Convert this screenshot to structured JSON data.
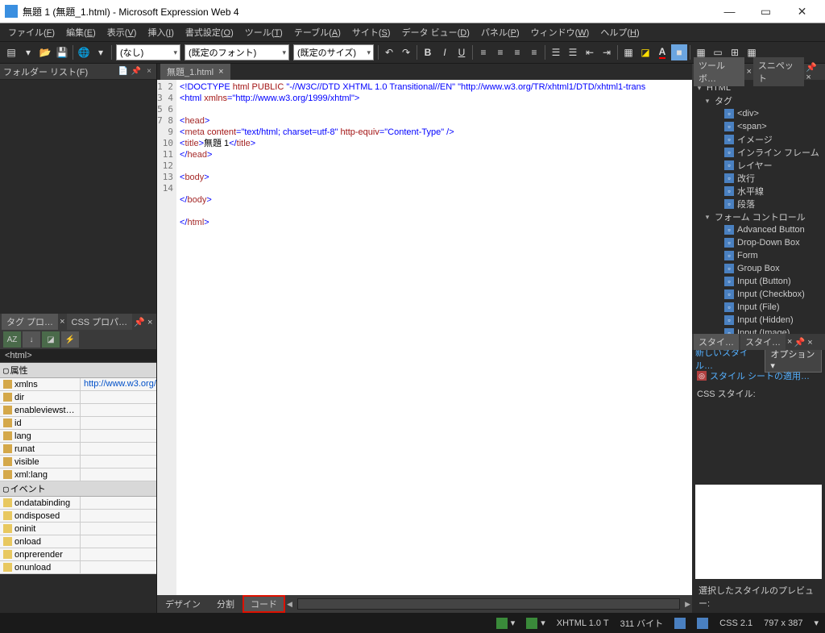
{
  "window": {
    "title": "無題 1 (無題_1.html) - Microsoft Expression Web 4"
  },
  "menus": [
    {
      "label": "ファイル",
      "mnemonic": "F"
    },
    {
      "label": "編集",
      "mnemonic": "E"
    },
    {
      "label": "表示",
      "mnemonic": "V"
    },
    {
      "label": "挿入",
      "mnemonic": "I"
    },
    {
      "label": "書式設定",
      "mnemonic": "O"
    },
    {
      "label": "ツール",
      "mnemonic": "T"
    },
    {
      "label": "テーブル",
      "mnemonic": "A"
    },
    {
      "label": "サイト",
      "mnemonic": "S"
    },
    {
      "label": "データ ビュー",
      "mnemonic": "D"
    },
    {
      "label": "パネル",
      "mnemonic": "P"
    },
    {
      "label": "ウィンドウ",
      "mnemonic": "W"
    },
    {
      "label": "ヘルプ",
      "mnemonic": "H"
    }
  ],
  "toolbar": {
    "style_combo": "(なし)",
    "font_combo": "(既定のフォント)",
    "size_combo": "(既定のサイズ)"
  },
  "folder_panel": {
    "title": "フォルダー リスト(F)"
  },
  "tag_panel": {
    "tab1": "タグ プロ…",
    "tab2": "CSS プロパ…",
    "crumb": "<html>",
    "group_attr": "属性",
    "attrs": [
      {
        "name": "xmlns",
        "value": "http://www.w3.org/…"
      },
      {
        "name": "dir",
        "value": ""
      },
      {
        "name": "enableviewst…",
        "value": ""
      },
      {
        "name": "id",
        "value": ""
      },
      {
        "name": "lang",
        "value": ""
      },
      {
        "name": "runat",
        "value": ""
      },
      {
        "name": "visible",
        "value": ""
      },
      {
        "name": "xml:lang",
        "value": ""
      }
    ],
    "group_event": "イベント",
    "events": [
      "ondatabinding",
      "ondisposed",
      "oninit",
      "onload",
      "onprerender",
      "onunload"
    ]
  },
  "doc": {
    "tab": "無題_1.html",
    "line_numbers": [
      "1",
      "2",
      "3",
      "4",
      "5",
      "6",
      "7",
      "8",
      "9",
      "10",
      "11",
      "12",
      "13",
      "14"
    ],
    "lines": [
      {
        "segs": [
          {
            "c": "t-blue",
            "t": "<!DOCTYPE"
          },
          {
            "c": "t-red",
            "t": " html PUBLIC "
          },
          {
            "c": "t-blue",
            "t": "\"-//W3C//DTD XHTML 1.0 Transitional//EN\" \"http://www.w3.org/TR/xhtml1/DTD/xhtml1-trans"
          }
        ]
      },
      {
        "segs": [
          {
            "c": "t-blue",
            "t": "<html "
          },
          {
            "c": "t-red",
            "t": "xmlns"
          },
          {
            "c": "t-blue",
            "t": "=\"http://www.w3.org/1999/xhtml\">"
          }
        ]
      },
      {
        "segs": []
      },
      {
        "segs": [
          {
            "c": "t-blue",
            "t": "<"
          },
          {
            "c": "t-brown",
            "t": "head"
          },
          {
            "c": "t-blue",
            "t": ">"
          }
        ]
      },
      {
        "segs": [
          {
            "c": "t-blue",
            "t": "<"
          },
          {
            "c": "t-brown",
            "t": "meta"
          },
          {
            "c": "t-red",
            "t": " content"
          },
          {
            "c": "t-blue",
            "t": "=\"text/html; charset=utf-8\""
          },
          {
            "c": "t-red",
            "t": " http-equiv"
          },
          {
            "c": "t-blue",
            "t": "=\"Content-Type\" />"
          }
        ]
      },
      {
        "segs": [
          {
            "c": "t-blue",
            "t": "<"
          },
          {
            "c": "t-brown",
            "t": "title"
          },
          {
            "c": "t-blue",
            "t": ">"
          },
          {
            "c": "t-black",
            "t": "無題 1"
          },
          {
            "c": "t-blue",
            "t": "</"
          },
          {
            "c": "t-brown",
            "t": "title"
          },
          {
            "c": "t-blue",
            "t": ">"
          }
        ]
      },
      {
        "segs": [
          {
            "c": "t-blue",
            "t": "</"
          },
          {
            "c": "t-brown",
            "t": "head"
          },
          {
            "c": "t-blue",
            "t": ">"
          }
        ]
      },
      {
        "segs": []
      },
      {
        "segs": [
          {
            "c": "t-blue",
            "t": "<"
          },
          {
            "c": "t-brown",
            "t": "body"
          },
          {
            "c": "t-blue",
            "t": ">"
          }
        ]
      },
      {
        "segs": []
      },
      {
        "segs": [
          {
            "c": "t-blue",
            "t": "</"
          },
          {
            "c": "t-brown",
            "t": "body"
          },
          {
            "c": "t-blue",
            "t": ">"
          }
        ]
      },
      {
        "segs": []
      },
      {
        "segs": [
          {
            "c": "t-blue",
            "t": "</"
          },
          {
            "c": "t-brown",
            "t": "html"
          },
          {
            "c": "t-blue",
            "t": ">"
          }
        ]
      },
      {
        "segs": []
      }
    ]
  },
  "view_tabs": {
    "design": "デザイン",
    "split": "分割",
    "code": "コード"
  },
  "toolbox": {
    "tab1": "ツールボ…",
    "tab2": "スニペット",
    "group_html": "HTML",
    "group_tags": "タグ",
    "tag_items": [
      "<div>",
      "<span>",
      "イメージ",
      "インライン フレーム",
      "レイヤー",
      "改行",
      "水平線",
      "段落"
    ],
    "group_form": "フォーム コントロール",
    "form_items": [
      "Advanced Button",
      "Drop-Down Box",
      "Form",
      "Group Box",
      "Input (Button)",
      "Input (Checkbox)",
      "Input (File)",
      "Input (Hidden)",
      "Input (Image)"
    ]
  },
  "style_panel": {
    "tab1": "スタイ…",
    "tab2": "スタイ…",
    "new_style": "新しいスタイル…",
    "options": "オプション",
    "apply_sheet": "スタイル シートの適用…",
    "css_styles": "CSS スタイル:",
    "preview_label": "選択したスタイルのプレビュー:"
  },
  "statusbar": {
    "doctype": "XHTML 1.0 T",
    "size": "311 バイト",
    "css": "CSS 2.1",
    "dimensions": "797 x 387"
  }
}
